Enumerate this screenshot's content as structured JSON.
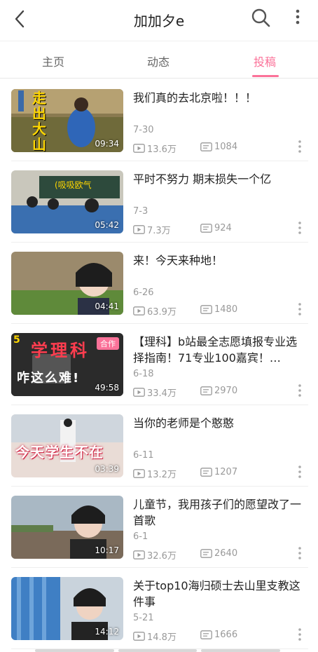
{
  "header": {
    "title": "加加夕e",
    "icons": [
      "back-arrow-icon",
      "search-icon",
      "more-vertical-icon"
    ]
  },
  "tabs": [
    {
      "label": "主页",
      "active": false
    },
    {
      "label": "动态",
      "active": false
    },
    {
      "label": "投稿",
      "active": true
    }
  ],
  "colors": {
    "accent": "#fb7299",
    "secondary_text": "#999999"
  },
  "videos": [
    {
      "title": "我们真的去北京啦！！！",
      "date": "7-30",
      "views": "13.6万",
      "danmaku": "1084",
      "duration": "09:34",
      "thumb_text": "走出大山"
    },
    {
      "title": "平时不努力 期末损失一个亿",
      "date": "7-3",
      "views": "7.3万",
      "danmaku": "924",
      "duration": "05:42",
      "thumb_text": "(吸吸欧气"
    },
    {
      "title": "来！今天来种地！",
      "date": "6-26",
      "views": "63.9万",
      "danmaku": "1480",
      "duration": "04:41"
    },
    {
      "title": "【理科】b站最全志愿填报专业选择指南！71专业100嘉宾！…",
      "date": "6-18",
      "views": "33.4万",
      "danmaku": "2970",
      "duration": "49:58",
      "badge": "合作",
      "thumb_num": "5",
      "thumb_text1": "学理科",
      "thumb_text2": "咋这么难!"
    },
    {
      "title": "当你的老师是个憨憨",
      "date": "6-11",
      "views": "13.2万",
      "danmaku": "1207",
      "duration": "03:39",
      "thumb_text": "今天学生不在"
    },
    {
      "title": "儿童节，我用孩子们的愿望改了一首歌",
      "date": "6-1",
      "views": "32.6万",
      "danmaku": "2640",
      "duration": "10:17"
    },
    {
      "title": "关于top10海归硕士去山里支教这件事",
      "date": "5-21",
      "views": "14.8万",
      "danmaku": "1666",
      "duration": "14:12"
    }
  ]
}
